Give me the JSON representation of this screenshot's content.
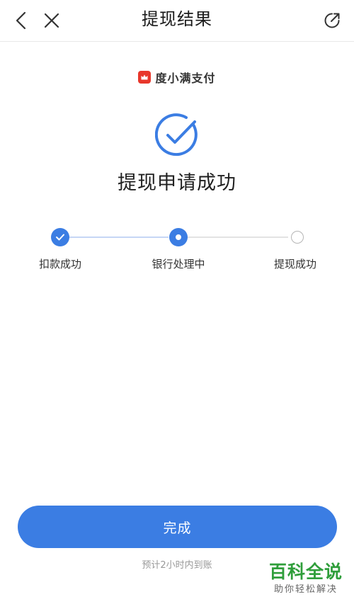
{
  "navbar": {
    "back_icon": "chevron-left-icon",
    "close_icon": "close-icon",
    "title": "提现结果",
    "share_icon": "share-icon"
  },
  "brand": {
    "name": "度小满支付",
    "logo_color": "#e8372b"
  },
  "result": {
    "icon": "check-circle-icon",
    "title": "提现申请成功"
  },
  "steps": [
    {
      "label": "扣款成功",
      "status": "done"
    },
    {
      "label": "银行处理中",
      "status": "current"
    },
    {
      "label": "提现成功",
      "status": "pending"
    }
  ],
  "footer": {
    "done_label": "完成",
    "eta": "预计2小时内到账"
  },
  "watermark": {
    "title": "百科全说",
    "subtitle": "助你轻松解决"
  },
  "colors": {
    "accent": "#3b7de3",
    "watermark_green": "#2f9e3b"
  }
}
